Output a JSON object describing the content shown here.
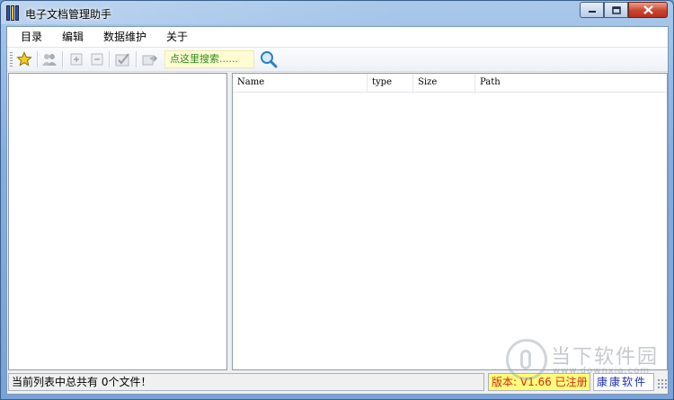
{
  "window": {
    "title": "电子文档管理助手"
  },
  "menu": [
    "目录",
    "编辑",
    "数据维护",
    "关于"
  ],
  "toolbar": {
    "search_label": "点这里搜索......",
    "icons": [
      "star-icon",
      "users-icon",
      "add-icon",
      "remove-icon",
      "check-icon",
      "move-icon",
      "search-icon"
    ]
  },
  "list": {
    "columns": [
      "Name",
      "type",
      "Size",
      "Path"
    ]
  },
  "status": {
    "text": "当前列表中总共有 0个文件！",
    "version": "版本: V1.66 已注册",
    "vendor": "康康软件"
  },
  "watermark": {
    "name": "当下软件园",
    "url": "www.downxia.com"
  },
  "colors": {
    "search_text": "#2b8a1e",
    "version_text": "#d4261a",
    "version_bg": "#ffff7a",
    "vendor_text": "#1c2fae"
  }
}
